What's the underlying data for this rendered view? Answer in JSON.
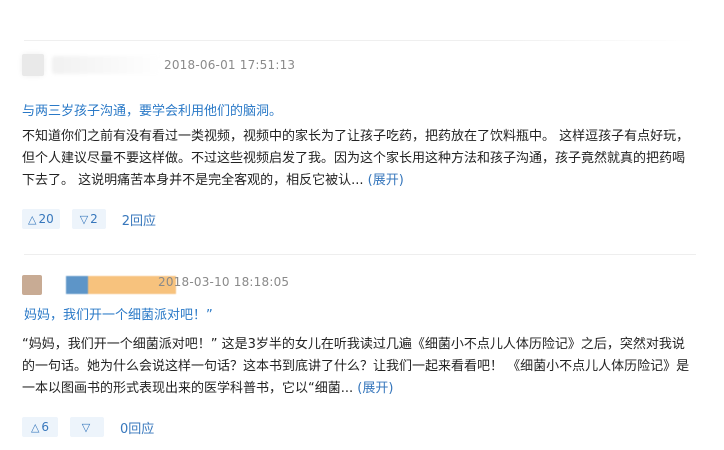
{
  "reviews": [
    {
      "date": "2018-06-01 17:51:13",
      "title": "与两三岁孩子沟通，要学会利用他们的脑洞。",
      "body": "不知道你们之前有没有看过一类视频，视频中的家长为了让孩子吃药，把药放在了饮料瓶中。 这样逗孩子有点好玩，但个人建议尽量不要这样做。不过这些视频启发了我。因为这个家长用这种方法和孩子沟通，孩子竟然就真的把药喝下去了。 这说明痛苦本身并不是完全客观的，相反它被认... ",
      "expand_label": "(展开)",
      "up_count": "20",
      "down_count": "2",
      "reply_label": "2回应"
    },
    {
      "date": "2018-03-10 18:18:05",
      "title": "妈妈，我们开一个细菌派对吧！”",
      "body": "“妈妈，我们开一个细菌派对吧！” 这是3岁半的女儿在听我读过几遍《细菌小不点儿人体历险记》之后，突然对我说的一句话。她为什么会说这样一句话？这本书到底讲了什么？让我们一起来看看吧！ 《细菌小不点儿人体历险记》是一本以图画书的形式表现出来的医学科普书，它以“细菌... ",
      "expand_label": "(展开)",
      "up_count": "6",
      "down_count": "",
      "reply_label": "0回应"
    }
  ],
  "icons": {
    "up": "triangle-up-icon",
    "down": "triangle-down-icon"
  },
  "colors": {
    "link": "#3777bc",
    "title": "#2a79c7",
    "vote_bg": "#edf4fb",
    "date": "#8a8a8a"
  }
}
